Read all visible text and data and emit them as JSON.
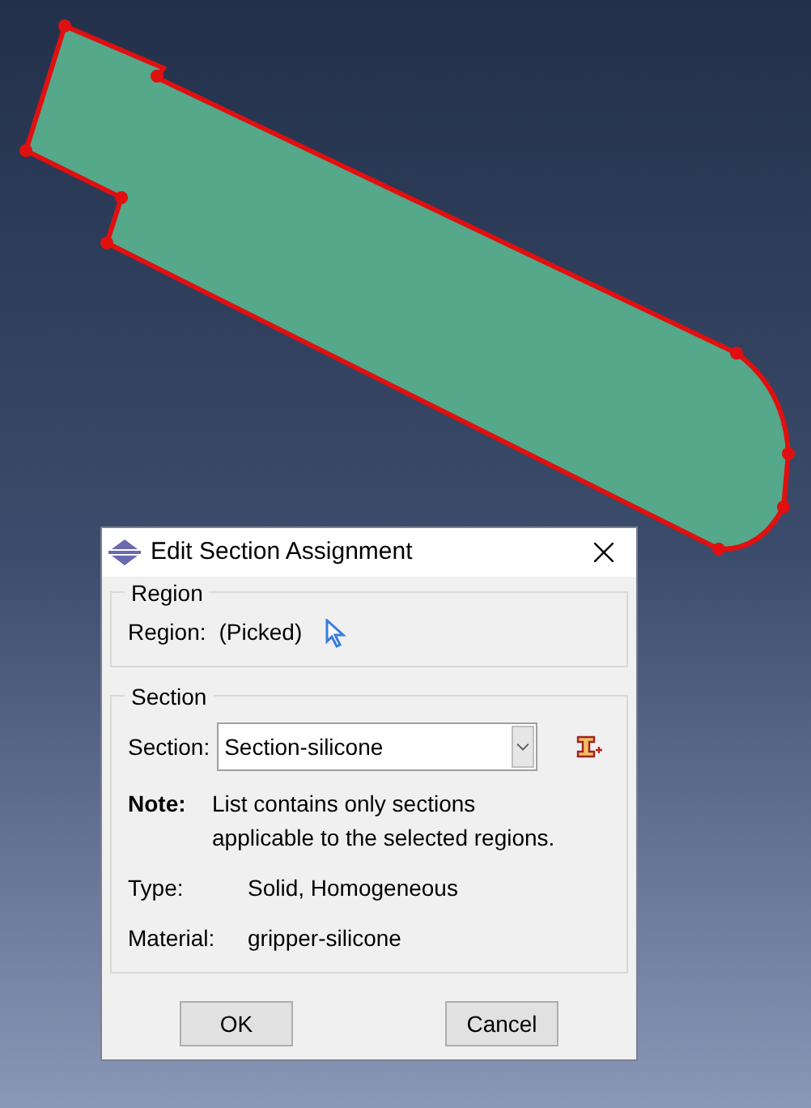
{
  "dialog": {
    "title": "Edit Section Assignment",
    "region_group": {
      "title": "Region",
      "label": "Region:",
      "value": "(Picked)"
    },
    "section_group": {
      "title": "Section",
      "label": "Section:",
      "selected_section": "Section-silicone",
      "note": {
        "label": "Note:",
        "text": "List contains only sections applicable to the selected regions."
      },
      "fields": [
        {
          "label": "Type:",
          "value": "Solid, Homogeneous"
        },
        {
          "label": "Material:",
          "value": "gripper-silicone"
        }
      ]
    },
    "buttons": [
      "OK",
      "Cancel"
    ]
  }
}
